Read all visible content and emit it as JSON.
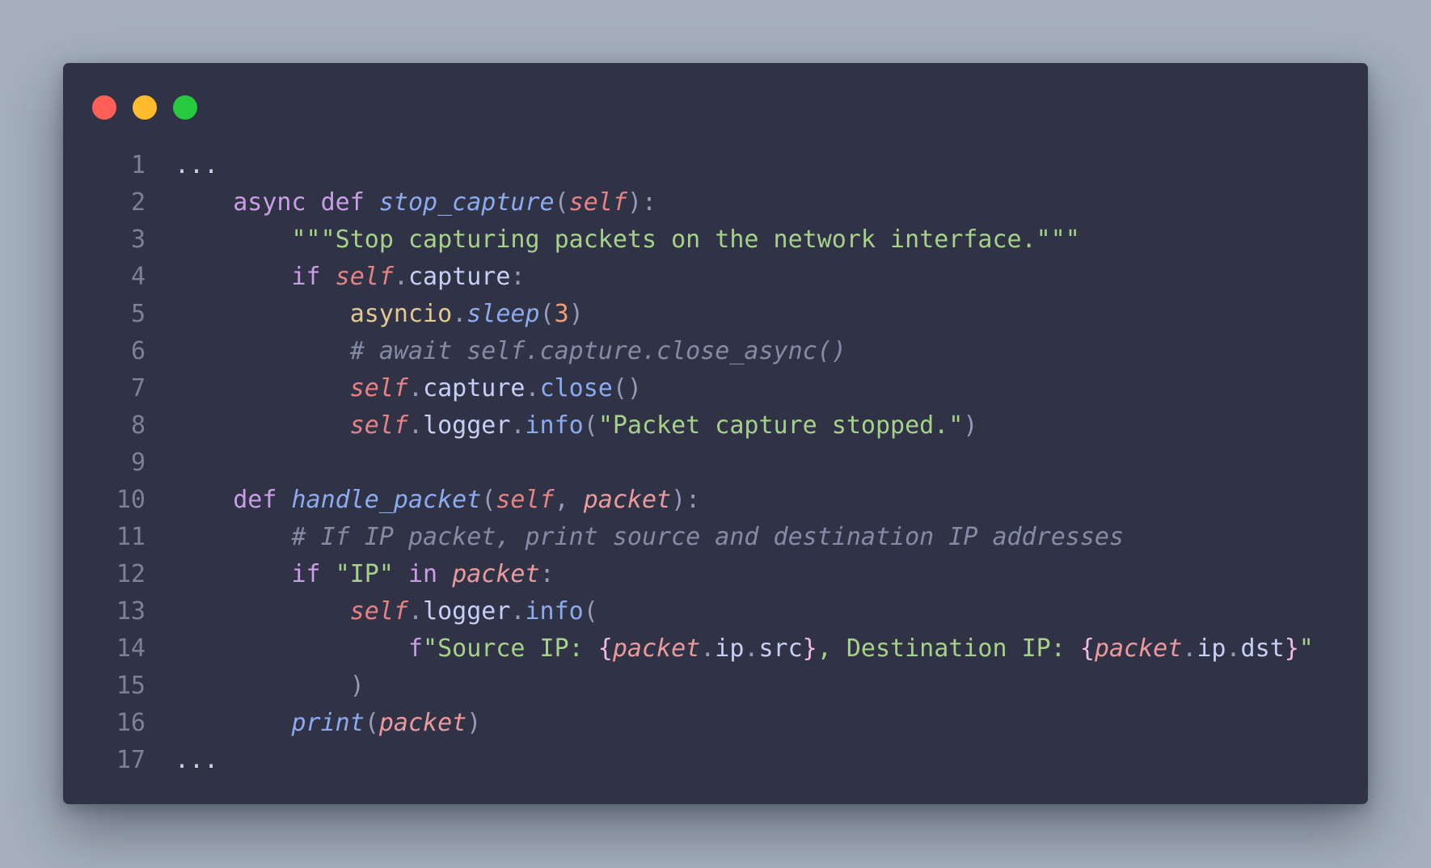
{
  "window": {
    "colors": {
      "close": "#ff5f56",
      "minimize": "#ffbd2e",
      "maximize": "#27c93f",
      "background": "#303346"
    }
  },
  "code": {
    "language": "python",
    "lines": [
      {
        "num": "1",
        "tokens": [
          {
            "t": "...",
            "c": "plain"
          }
        ]
      },
      {
        "num": "2",
        "tokens": [
          {
            "t": "    ",
            "c": "plain"
          },
          {
            "t": "async",
            "c": "kw"
          },
          {
            "t": " ",
            "c": "plain"
          },
          {
            "t": "def",
            "c": "kw"
          },
          {
            "t": " ",
            "c": "plain"
          },
          {
            "t": "stop_capture",
            "c": "fn"
          },
          {
            "t": "(",
            "c": "punc"
          },
          {
            "t": "self",
            "c": "self"
          },
          {
            "t": "):",
            "c": "punc"
          }
        ]
      },
      {
        "num": "3",
        "tokens": [
          {
            "t": "        ",
            "c": "plain"
          },
          {
            "t": "\"\"\"Stop capturing packets on the network interface.\"\"\"",
            "c": "str"
          }
        ]
      },
      {
        "num": "4",
        "tokens": [
          {
            "t": "        ",
            "c": "plain"
          },
          {
            "t": "if",
            "c": "kw"
          },
          {
            "t": " ",
            "c": "plain"
          },
          {
            "t": "self",
            "c": "self"
          },
          {
            "t": ".",
            "c": "punc"
          },
          {
            "t": "capture",
            "c": "attr"
          },
          {
            "t": ":",
            "c": "punc"
          }
        ]
      },
      {
        "num": "5",
        "tokens": [
          {
            "t": "            ",
            "c": "plain"
          },
          {
            "t": "asyncio",
            "c": "cls"
          },
          {
            "t": ".",
            "c": "punc"
          },
          {
            "t": "sleep",
            "c": "fn"
          },
          {
            "t": "(",
            "c": "punc"
          },
          {
            "t": "3",
            "c": "num"
          },
          {
            "t": ")",
            "c": "punc"
          }
        ]
      },
      {
        "num": "6",
        "tokens": [
          {
            "t": "            ",
            "c": "plain"
          },
          {
            "t": "# await self.capture.close_async()",
            "c": "cmt"
          }
        ]
      },
      {
        "num": "7",
        "tokens": [
          {
            "t": "            ",
            "c": "plain"
          },
          {
            "t": "self",
            "c": "self"
          },
          {
            "t": ".",
            "c": "punc"
          },
          {
            "t": "capture",
            "c": "attr"
          },
          {
            "t": ".",
            "c": "punc"
          },
          {
            "t": "close",
            "c": "meth"
          },
          {
            "t": "()",
            "c": "punc"
          }
        ]
      },
      {
        "num": "8",
        "tokens": [
          {
            "t": "            ",
            "c": "plain"
          },
          {
            "t": "self",
            "c": "self"
          },
          {
            "t": ".",
            "c": "punc"
          },
          {
            "t": "logger",
            "c": "attr"
          },
          {
            "t": ".",
            "c": "punc"
          },
          {
            "t": "info",
            "c": "meth"
          },
          {
            "t": "(",
            "c": "punc"
          },
          {
            "t": "\"Packet capture stopped.\"",
            "c": "str"
          },
          {
            "t": ")",
            "c": "punc"
          }
        ]
      },
      {
        "num": "9",
        "tokens": []
      },
      {
        "num": "10",
        "tokens": [
          {
            "t": "    ",
            "c": "plain"
          },
          {
            "t": "def",
            "c": "kw"
          },
          {
            "t": " ",
            "c": "plain"
          },
          {
            "t": "handle_packet",
            "c": "fn"
          },
          {
            "t": "(",
            "c": "punc"
          },
          {
            "t": "self",
            "c": "self"
          },
          {
            "t": ", ",
            "c": "punc"
          },
          {
            "t": "packet",
            "c": "param"
          },
          {
            "t": "):",
            "c": "punc"
          }
        ]
      },
      {
        "num": "11",
        "tokens": [
          {
            "t": "        ",
            "c": "plain"
          },
          {
            "t": "# If IP packet, print source and destination IP addresses",
            "c": "cmt"
          }
        ]
      },
      {
        "num": "12",
        "tokens": [
          {
            "t": "        ",
            "c": "plain"
          },
          {
            "t": "if",
            "c": "kw"
          },
          {
            "t": " ",
            "c": "plain"
          },
          {
            "t": "\"IP\"",
            "c": "str"
          },
          {
            "t": " ",
            "c": "plain"
          },
          {
            "t": "in",
            "c": "kw"
          },
          {
            "t": " ",
            "c": "plain"
          },
          {
            "t": "packet",
            "c": "param"
          },
          {
            "t": ":",
            "c": "punc"
          }
        ]
      },
      {
        "num": "13",
        "tokens": [
          {
            "t": "            ",
            "c": "plain"
          },
          {
            "t": "self",
            "c": "self"
          },
          {
            "t": ".",
            "c": "punc"
          },
          {
            "t": "logger",
            "c": "attr"
          },
          {
            "t": ".",
            "c": "punc"
          },
          {
            "t": "info",
            "c": "meth"
          },
          {
            "t": "(",
            "c": "punc"
          }
        ]
      },
      {
        "num": "14",
        "tokens": [
          {
            "t": "                ",
            "c": "plain"
          },
          {
            "t": "f",
            "c": "kw"
          },
          {
            "t": "\"Source IP: ",
            "c": "str"
          },
          {
            "t": "{",
            "c": "brace"
          },
          {
            "t": "packet",
            "c": "param"
          },
          {
            "t": ".",
            "c": "punc"
          },
          {
            "t": "ip",
            "c": "attr"
          },
          {
            "t": ".",
            "c": "punc"
          },
          {
            "t": "src",
            "c": "attr"
          },
          {
            "t": "}",
            "c": "brace"
          },
          {
            "t": ", Destination IP: ",
            "c": "str"
          },
          {
            "t": "{",
            "c": "brace"
          },
          {
            "t": "packet",
            "c": "param"
          },
          {
            "t": ".",
            "c": "punc"
          },
          {
            "t": "ip",
            "c": "attr"
          },
          {
            "t": ".",
            "c": "punc"
          },
          {
            "t": "dst",
            "c": "attr"
          },
          {
            "t": "}",
            "c": "brace"
          },
          {
            "t": "\"",
            "c": "str"
          }
        ]
      },
      {
        "num": "15",
        "tokens": [
          {
            "t": "            ",
            "c": "plain"
          },
          {
            "t": ")",
            "c": "punc"
          }
        ]
      },
      {
        "num": "16",
        "tokens": [
          {
            "t": "        ",
            "c": "plain"
          },
          {
            "t": "print",
            "c": "fn"
          },
          {
            "t": "(",
            "c": "punc"
          },
          {
            "t": "packet",
            "c": "param"
          },
          {
            "t": ")",
            "c": "punc"
          }
        ]
      },
      {
        "num": "17",
        "tokens": [
          {
            "t": "...",
            "c": "plain"
          }
        ]
      }
    ]
  }
}
